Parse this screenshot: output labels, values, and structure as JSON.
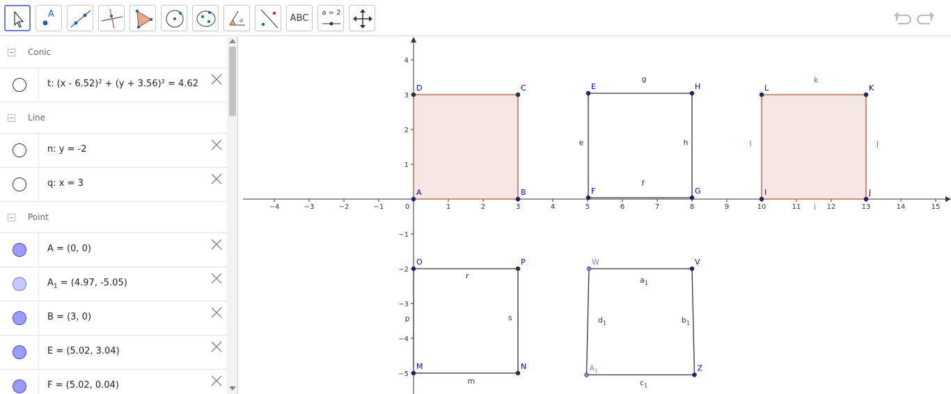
{
  "toolbar": {
    "tools": [
      {
        "name": "move-tool",
        "icon": "pointer-icon"
      },
      {
        "name": "point-tool",
        "icon": "point-icon",
        "label": "A"
      },
      {
        "name": "line-tool",
        "icon": "line-icon"
      },
      {
        "name": "perpendicular-tool",
        "icon": "perpendicular-icon"
      },
      {
        "name": "polygon-tool",
        "icon": "polygon-icon"
      },
      {
        "name": "circle-tool",
        "icon": "circle-icon"
      },
      {
        "name": "ellipse-tool",
        "icon": "ellipse-icon"
      },
      {
        "name": "angle-tool",
        "icon": "angle-icon"
      },
      {
        "name": "reflect-tool",
        "icon": "reflect-icon"
      },
      {
        "name": "text-tool",
        "icon": "text-icon",
        "label": "ABC"
      },
      {
        "name": "slider-tool",
        "icon": "slider-icon",
        "label": "a = 2"
      },
      {
        "name": "move-view-tool",
        "icon": "move-view-icon"
      }
    ],
    "undo_icon": "undo-icon",
    "redo_icon": "redo-icon"
  },
  "algebra": {
    "conic_label": "Conic",
    "line_label": "Line",
    "point_label": "Point",
    "conic_t": "t: (x - 6.52)² + (y + 3.56)² = 4.62",
    "line_n": "n: y = -2",
    "line_q": "q: x = 3",
    "point_A": "A = (0, 0)",
    "point_A1_main": "A",
    "point_A1_sub": "1",
    "point_A1_rest": " = (4.97, -5.05)",
    "point_B": "B = (3, 0)",
    "point_E": "E = (5.02, 3.04)",
    "point_F": "F = (5.02, 0.04)"
  },
  "graph": {
    "x_ticks": [
      "−4",
      "−3",
      "−2",
      "−1",
      "0",
      "1",
      "2",
      "3",
      "4",
      "5",
      "6",
      "7",
      "8",
      "9",
      "10",
      "11",
      "12",
      "13",
      "14",
      "15"
    ],
    "y_ticks": [
      "4",
      "3",
      "2",
      "1",
      "−1",
      "−2",
      "−3",
      "−4",
      "−5"
    ],
    "points": {
      "A": "A",
      "B": "B",
      "C": "C",
      "D": "D",
      "E": "E",
      "F": "F",
      "G": "G",
      "H": "H",
      "I": "I",
      "J": "J",
      "K": "K",
      "L": "L",
      "M": "M",
      "N": "N",
      "O": "O",
      "P": "P",
      "V": "V",
      "W": "W",
      "Z": "Z",
      "A1": "A"
    },
    "segments": {
      "e": "e",
      "f": "f",
      "g": "g",
      "h": "h",
      "i": "i",
      "j": "j",
      "k": "k",
      "l": "l",
      "m": "m",
      "p": "p",
      "r": "r",
      "s": "s",
      "a1": "a",
      "b1": "b",
      "c1": "c",
      "d1": "d",
      "sub1": "1"
    },
    "colors": {
      "point": "#0000cc",
      "fill": "#f4e6e2",
      "stroke_brown": "#b5583c",
      "axis": "#333333"
    }
  }
}
